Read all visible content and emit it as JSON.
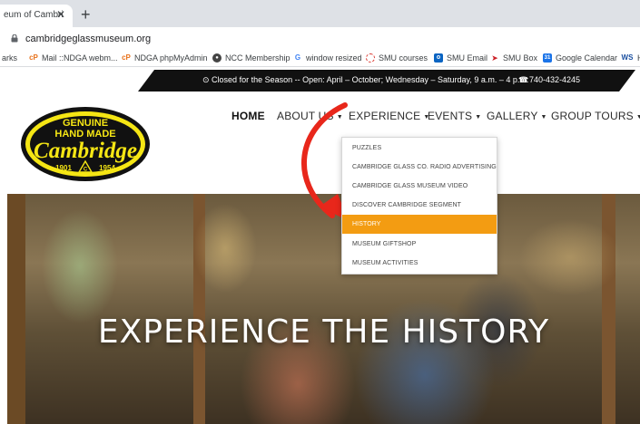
{
  "browser": {
    "tab_title": "eum of Cambri",
    "url": "cambridgeglassmuseum.org",
    "bookmarks": [
      {
        "label": "arks",
        "icon": "bookmark-icon"
      },
      {
        "label": "Mail ::NDGA webm...",
        "icon": "cpanel-icon"
      },
      {
        "label": "NDGA phpMyAdmin",
        "icon": "cpanel-icon"
      },
      {
        "label": "NCC Membership",
        "icon": "globe-icon"
      },
      {
        "label": "window resized",
        "icon": "google-icon"
      },
      {
        "label": "SMU courses",
        "icon": "smu-icon"
      },
      {
        "label": "SMU Email",
        "icon": "outlook-icon"
      },
      {
        "label": "SMU Box",
        "icon": "mustang-icon"
      },
      {
        "label": "Google Calendar",
        "icon": "calendar-icon"
      },
      {
        "label": "H",
        "icon": "ws-icon"
      }
    ]
  },
  "infobar": {
    "hours": "Closed for the Season -- Open: April – October; Wednesday – Saturday, 9 a.m. – 4 p.m.",
    "phone": "740-432-4245"
  },
  "logo": {
    "line1": "GENUINE",
    "line2": "HAND MADE",
    "line3": "Cambridge",
    "year_left": "1901",
    "year_right": "1954",
    "triangle": "C"
  },
  "nav": {
    "home": "HOME",
    "about": "ABOUT US",
    "experience": "EXPERIENCE",
    "events": "EVENTS",
    "gallery": "GALLERY",
    "group_tours": "GROUP TOURS"
  },
  "dropdown": [
    "PUZZLES",
    "CAMBRIDGE GLASS CO. RADIO ADVERTISING",
    "CAMBRIDGE GLASS MUSEUM VIDEO",
    "DISCOVER CAMBRIDGE SEGMENT",
    "HISTORY",
    "MUSEUM GIFTSHOP",
    "MUSEUM ACTIVITIES"
  ],
  "hero": {
    "title": "EXPERIENCE THE HISTORY"
  },
  "colors": {
    "accent": "#f39c12",
    "arrow": "#e8271b",
    "logo_yellow": "#f5e614"
  }
}
